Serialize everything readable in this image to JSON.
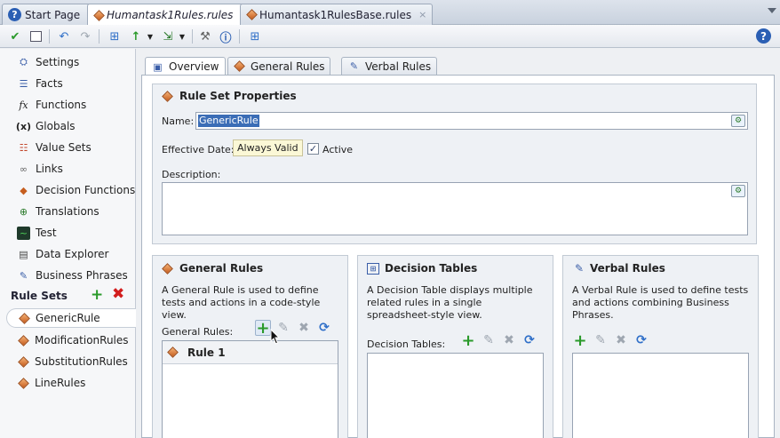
{
  "tabs": [
    {
      "label": "Start Page",
      "icon": "help-icon"
    },
    {
      "label": "Humantask1Rules.rules",
      "icon": "ruleset-icon",
      "active": true
    },
    {
      "label": "Humantask1RulesBase.rules",
      "icon": "ruleset-icon"
    }
  ],
  "tab_close_glyph": "×",
  "help_glyph": "?",
  "sidebar": {
    "items": [
      {
        "label": "Settings",
        "icon": "settings-icon"
      },
      {
        "label": "Facts",
        "icon": "facts-icon"
      },
      {
        "label": "Functions",
        "icon": "function-icon"
      },
      {
        "label": "Globals",
        "icon": "globals-icon"
      },
      {
        "label": "Value Sets",
        "icon": "valuesets-icon"
      },
      {
        "label": "Links",
        "icon": "link-icon"
      },
      {
        "label": "Decision Functions",
        "icon": "decision-function-icon"
      },
      {
        "label": "Translations",
        "icon": "translation-icon"
      },
      {
        "label": "Test",
        "icon": "test-icon"
      },
      {
        "label": "Data Explorer",
        "icon": "data-explorer-icon"
      },
      {
        "label": "Business Phrases",
        "icon": "business-phrases-icon"
      }
    ],
    "rule_sets_heading": "Rule Sets",
    "rule_sets": [
      {
        "label": "GenericRule",
        "selected": true
      },
      {
        "label": "ModificationRules"
      },
      {
        "label": "SubstitutionRules"
      },
      {
        "label": "LineRules"
      }
    ]
  },
  "subtabs": [
    {
      "label": "Overview",
      "active": true
    },
    {
      "label": "General Rules"
    },
    {
      "label": "Verbal Rules"
    }
  ],
  "properties": {
    "title": "Rule Set Properties",
    "name_label": "Name:",
    "name_value": "GenericRule",
    "effective_date_label": "Effective Date:",
    "effective_date_value": "Always Valid",
    "active_label": "Active",
    "active_checked": true,
    "description_label": "Description:"
  },
  "general_rules": {
    "title": "General Rules",
    "description": "A General Rule is used to define tests and actions in a code-style view.",
    "list_label": "General Rules:",
    "rules": [
      "Rule 1"
    ]
  },
  "decision_tables": {
    "title": "Decision Tables",
    "description": "A Decision Table displays multiple related rules in a single spreadsheet-style view.",
    "list_label": "Decision Tables:"
  },
  "verbal_rules": {
    "title": "Verbal Rules",
    "description": "A Verbal Rule is used to define tests and actions combining Business Phrases."
  }
}
